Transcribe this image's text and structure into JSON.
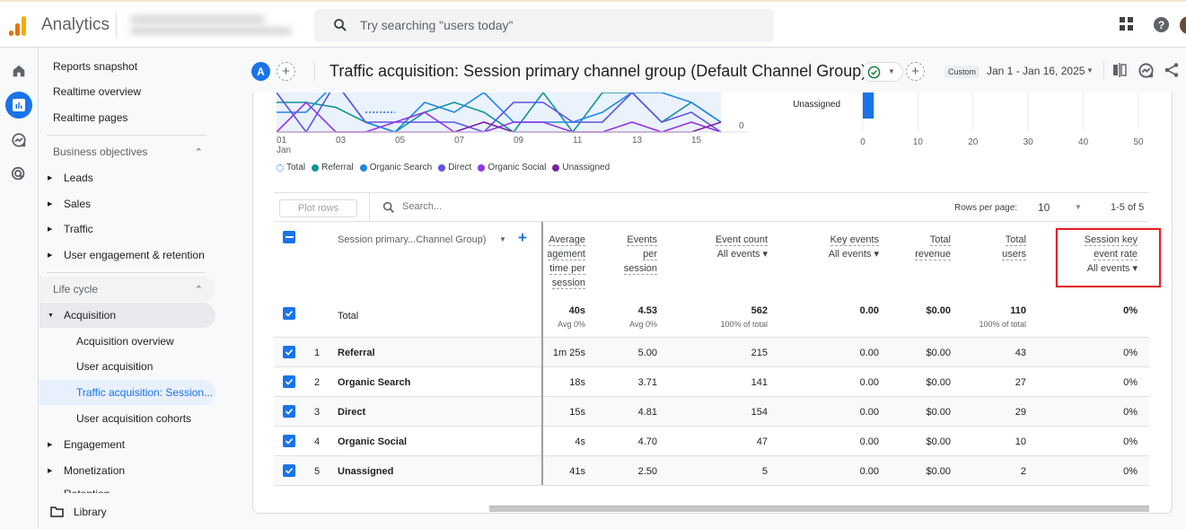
{
  "app": {
    "name": "Analytics",
    "search_placeholder": "Try searching \"users today\"",
    "logo_colors": [
      "#f9ab00",
      "#e37400",
      "#e37400"
    ]
  },
  "top_icons": [
    "apps-grid-icon",
    "help-icon",
    "account-avatar"
  ],
  "rail": [
    {
      "name": "home-icon",
      "active": false
    },
    {
      "name": "reports-icon",
      "active": true
    },
    {
      "name": "explore-icon",
      "active": false
    },
    {
      "name": "advertising-icon",
      "active": false
    }
  ],
  "nav": {
    "top_items": [
      "Reports snapshot",
      "Realtime overview",
      "Realtime pages"
    ],
    "business_objectives": {
      "label": "Business objectives",
      "items": [
        "Leads",
        "Sales",
        "Traffic",
        "User engagement & retention"
      ]
    },
    "life_cycle": {
      "label": "Life cycle",
      "acquisition": {
        "label": "Acquisition",
        "items": [
          "Acquisition overview",
          "User acquisition",
          "Traffic acquisition: Session...",
          "User acquisition cohorts"
        ],
        "selected_index": 2
      },
      "items_after": [
        "Engagement",
        "Monetization",
        "Retention"
      ]
    },
    "library": "Library"
  },
  "header": {
    "avatar_letter": "A",
    "title": "Traffic acquisition: Session primary channel group (Default Channel Group)",
    "custom_label": "Custom",
    "date_range": "Jan 1 - Jan 16, 2025"
  },
  "chart_data": [
    {
      "type": "line",
      "title": "",
      "x": [
        "01",
        "02",
        "03",
        "04",
        "05",
        "06",
        "07",
        "08",
        "09",
        "10",
        "11",
        "12",
        "13",
        "14",
        "15",
        "16"
      ],
      "x_tick_labels": [
        "01\nJan",
        "03",
        "05",
        "07",
        "09",
        "11",
        "13",
        "15"
      ],
      "y_tick_labels": [
        "0"
      ],
      "visible_y_range": [
        0,
        4
      ],
      "series": [
        {
          "name": "Total",
          "color": "#1a73e8",
          "style": "dotted",
          "values": [
            null,
            null,
            null,
            2,
            2,
            null,
            null,
            null,
            null,
            null,
            1,
            null,
            null,
            null,
            null,
            null
          ]
        },
        {
          "name": "Referral",
          "color": "#12939a",
          "values": [
            3,
            3,
            2.5,
            1,
            0,
            2,
            3,
            2,
            0,
            4,
            0,
            4,
            4,
            1,
            3,
            1
          ]
        },
        {
          "name": "Organic Search",
          "color": "#1e88e5",
          "values": [
            2,
            2,
            5,
            1,
            0,
            3,
            2,
            4,
            1,
            1,
            1,
            2,
            4,
            4,
            3,
            1
          ]
        },
        {
          "name": "Direct",
          "color": "#5c55e0",
          "values": [
            4,
            0,
            5,
            1,
            1,
            1,
            1,
            0,
            3,
            3,
            1,
            1,
            4,
            1,
            2,
            0
          ]
        },
        {
          "name": "Organic Social",
          "color": "#9334e6",
          "values": [
            0,
            3,
            0,
            0,
            1,
            2,
            0,
            0,
            1,
            1,
            0,
            0,
            1,
            0,
            1,
            0
          ]
        },
        {
          "name": "Unassigned",
          "color": "#7b1fa2",
          "values": [
            0,
            0,
            0,
            0,
            0,
            0,
            0,
            1,
            0,
            0,
            0,
            0,
            0,
            0,
            0,
            1
          ]
        }
      ]
    },
    {
      "type": "bar",
      "orientation": "horizontal",
      "categories": [
        "Unassigned"
      ],
      "values": [
        2
      ],
      "xlim": [
        0,
        50
      ],
      "x_tick_labels": [
        "0",
        "10",
        "20",
        "30",
        "40",
        "50"
      ],
      "color": "#1a73e8"
    }
  ],
  "toolbar": {
    "plot_rows": "Plot rows",
    "search_placeholder": "Search...",
    "rows_per_page_label": "Rows per page:",
    "rows_per_page": "10",
    "pagination": "1-5 of 5"
  },
  "table": {
    "dimension_header": "Session primary...Channel Group)",
    "columns": [
      {
        "lines": [
          "Average",
          "engagement",
          "time per",
          "session"
        ],
        "selector": null
      },
      {
        "lines": [
          "Events",
          "per",
          "session"
        ],
        "selector": null
      },
      {
        "lines": [
          "Event count"
        ],
        "selector": "All events"
      },
      {
        "lines": [
          "Key events"
        ],
        "selector": "All events"
      },
      {
        "lines": [
          "Total",
          "revenue"
        ],
        "selector": null
      },
      {
        "lines": [
          "Total",
          "users"
        ],
        "selector": null
      },
      {
        "lines": [
          "Session key",
          "event rate"
        ],
        "selector": "All events"
      }
    ],
    "total": {
      "label": "Total",
      "values": [
        "40s",
        "4.53",
        "562",
        "0.00",
        "$0.00",
        "110",
        "0%"
      ],
      "subs": [
        "Avg 0%",
        "Avg 0%",
        "100% of total",
        "",
        "",
        "100% of total",
        ""
      ]
    },
    "rows": [
      {
        "rank": "1",
        "name": "Referral",
        "values": [
          "1m 25s",
          "5.00",
          "215",
          "0.00",
          "$0.00",
          "43",
          "0%"
        ]
      },
      {
        "rank": "2",
        "name": "Organic Search",
        "values": [
          "18s",
          "3.71",
          "141",
          "0.00",
          "$0.00",
          "27",
          "0%"
        ]
      },
      {
        "rank": "3",
        "name": "Direct",
        "values": [
          "15s",
          "4.81",
          "154",
          "0.00",
          "$0.00",
          "29",
          "0%"
        ]
      },
      {
        "rank": "4",
        "name": "Organic Social",
        "values": [
          "4s",
          "4.70",
          "47",
          "0.00",
          "$0.00",
          "10",
          "0%"
        ]
      },
      {
        "rank": "5",
        "name": "Unassigned",
        "values": [
          "41s",
          "2.50",
          "5",
          "0.00",
          "$0.00",
          "2",
          "0%"
        ]
      }
    ],
    "highlighted_column": "Session key event rate"
  }
}
